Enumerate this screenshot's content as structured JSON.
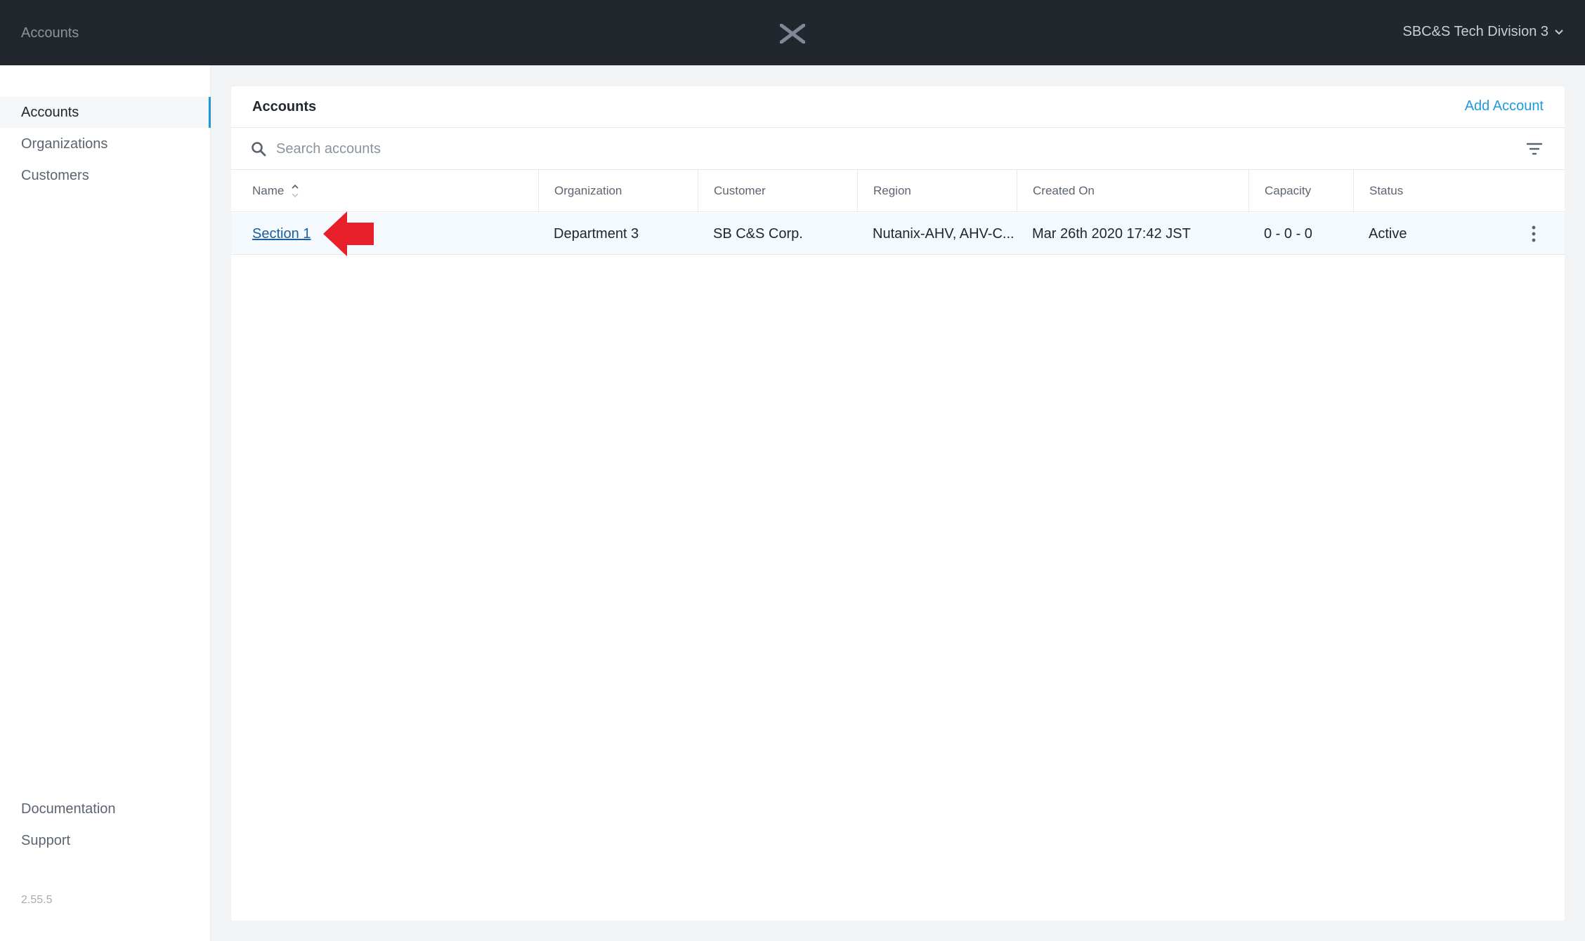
{
  "header": {
    "breadcrumb": "Accounts",
    "tenant": "SBC&S Tech Division 3"
  },
  "sidebar": {
    "items": [
      {
        "label": "Accounts"
      },
      {
        "label": "Organizations"
      },
      {
        "label": "Customers"
      }
    ],
    "bottom": [
      {
        "label": "Documentation"
      },
      {
        "label": "Support"
      }
    ],
    "version": "2.55.5"
  },
  "panel": {
    "title": "Accounts",
    "add_label": "Add Account",
    "search": {
      "placeholder": "Search accounts",
      "value": ""
    }
  },
  "table": {
    "columns": [
      "Name",
      "Organization",
      "Customer",
      "Region",
      "Created On",
      "Capacity",
      "Status"
    ],
    "rows": [
      {
        "name": "Section 1",
        "organization": "Department 3",
        "customer": "SB C&S Corp.",
        "region": "Nutanix-AHV, AHV-C...",
        "created_on": "Mar 26th 2020 17:42 JST",
        "capacity": "0 - 0 - 0",
        "status": "Active"
      }
    ]
  },
  "colors": {
    "accent": "#1b9ae0",
    "header_bg": "#22272e",
    "annotation_arrow": "#e8202a"
  },
  "icons": [
    "nutanix-logo-icon",
    "chevron-down-icon",
    "search-icon",
    "filter-icon",
    "sort-icon",
    "more-vertical-icon",
    "red-arrow-annotation-icon"
  ]
}
